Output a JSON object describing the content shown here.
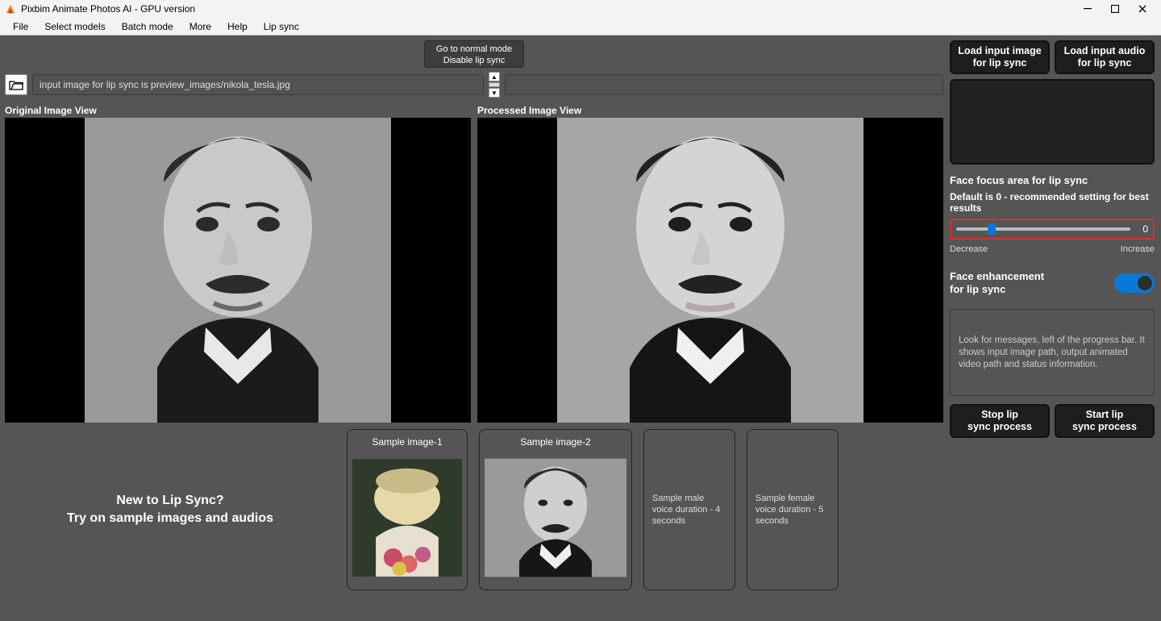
{
  "window": {
    "title": "Pixbim Animate Photos AI - GPU version"
  },
  "menu": {
    "items": [
      "File",
      "Select models",
      "Batch mode",
      "More",
      "Help",
      "Lip sync"
    ]
  },
  "mode_button": {
    "line1": "Go to normal mode",
    "line2": "Disable lip sync"
  },
  "path_row": {
    "image_path": "input image for lip sync is preview_images/nikola_tesla.jpg"
  },
  "views": {
    "original_label": "Original Image View",
    "processed_label": "Processed Image View"
  },
  "samples": {
    "intro_line1": "New to Lip Sync?",
    "intro_line2": "Try on sample images and audios",
    "image1_caption": "Sample image-1",
    "image2_caption": "Sample image-2",
    "voice1": "Sample male voice duration - 4 seconds",
    "voice2": "Sample female voice duration - 5 seconds"
  },
  "sidebar": {
    "load_image_line1": "Load input image",
    "load_image_line2": "for lip sync",
    "load_audio_line1": "Load input audio",
    "load_audio_line2": "for lip sync",
    "focus_header": "Face focus area for lip sync",
    "focus_sub": "Default is 0 - recommended setting for best results",
    "slider_value": "0",
    "decrease": "Decrease",
    "increase": "Increase",
    "enh_line1": "Face enhancement",
    "enh_line2": "for lip sync",
    "msg": "Look for messages, left of the progress bar. It shows input image path, output animated video path and status information.",
    "stop_line1": "Stop lip",
    "stop_line2": "sync process",
    "start_line1": "Start lip",
    "start_line2": "sync process"
  }
}
